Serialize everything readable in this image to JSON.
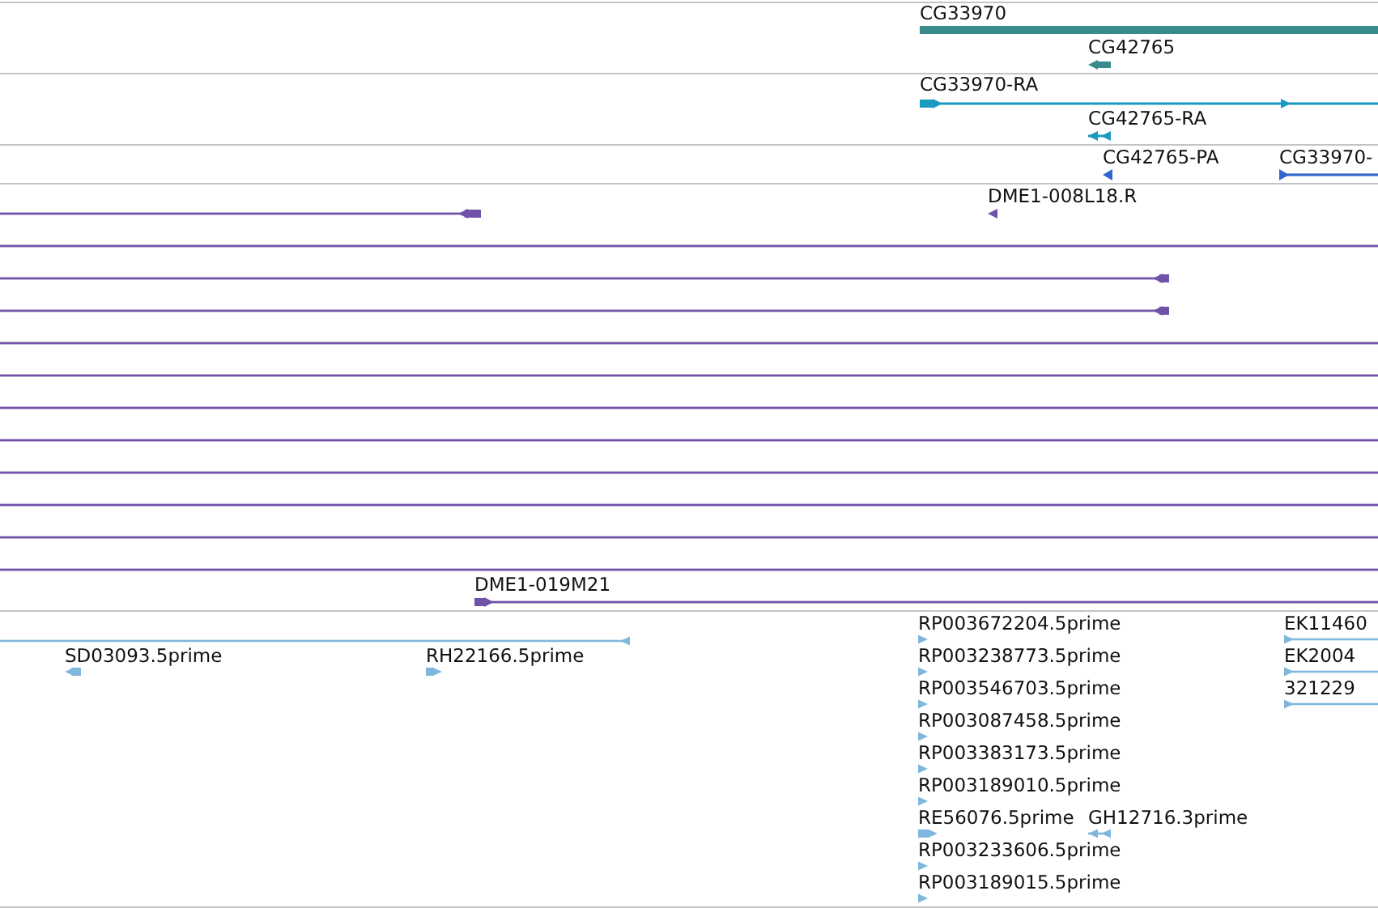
{
  "tracks": [
    {
      "kind": "gene",
      "color": "#3a8c8c",
      "features": [
        {
          "kind": "span",
          "label": "CG33970"
        },
        {
          "kind": "arrow",
          "label": "CG42765",
          "reverse": true
        }
      ]
    },
    {
      "kind": "transcript",
      "color": "#1b9ac0",
      "features": [
        {
          "kind": "arrow",
          "label": "CG33970-RA",
          "reverse": false
        },
        {
          "kind": "arrow",
          "label": "CG42765-RA",
          "reverse": true
        }
      ]
    },
    {
      "kind": "protein",
      "color": "#3366cc",
      "features": [
        {
          "kind": "arrow",
          "label": "CG42765-PA",
          "reverse": true
        },
        {
          "kind": "arrow",
          "label": "CG33970-",
          "reverse": false
        }
      ]
    },
    {
      "kind": "clone",
      "color": "#7052a8",
      "features": [
        {
          "kind": "arrow",
          "label": "DME1-008L18.R",
          "reverse": true
        },
        {
          "kind": "arrow",
          "reverse": true
        },
        {
          "kind": "span"
        },
        {
          "kind": "arrow",
          "reverse": true
        },
        {
          "kind": "arrow",
          "reverse": true
        },
        {
          "kind": "span"
        },
        {
          "kind": "span"
        },
        {
          "kind": "span"
        },
        {
          "kind": "span"
        },
        {
          "kind": "span"
        },
        {
          "kind": "span"
        },
        {
          "kind": "span"
        },
        {
          "kind": "span"
        },
        {
          "kind": "arrow",
          "label": "DME1-019M21",
          "reverse": false
        }
      ]
    },
    {
      "kind": "est",
      "color": "#7fb8dc",
      "features": [
        {
          "kind": "arrow",
          "reverse": true
        },
        {
          "kind": "arrow",
          "label": "RP003672204.5prime",
          "reverse": false
        },
        {
          "kind": "arrow",
          "label": "EK11460",
          "reverse": false
        },
        {
          "kind": "arrow",
          "label": "SD03093.5prime",
          "reverse": true
        },
        {
          "kind": "arrow",
          "label": "RH22166.5prime",
          "reverse": false
        },
        {
          "kind": "arrow",
          "label": "RP003238773.5prime",
          "reverse": false
        },
        {
          "kind": "arrow",
          "label": "EK2004",
          "reverse": false
        },
        {
          "kind": "arrow",
          "label": "RP003546703.5prime",
          "reverse": false
        },
        {
          "kind": "arrow",
          "label": "321229",
          "reverse": false
        },
        {
          "kind": "arrow",
          "label": "RP003087458.5prime",
          "reverse": false
        },
        {
          "kind": "arrow",
          "label": "RP003383173.5prime",
          "reverse": false
        },
        {
          "kind": "arrow",
          "label": "RP003189010.5prime",
          "reverse": false
        },
        {
          "kind": "arrow",
          "label": "RE56076.5prime",
          "reverse": false
        },
        {
          "kind": "arrow",
          "label": "GH12716.3prime",
          "reverse": true
        },
        {
          "kind": "arrow",
          "label": "RP003233606.5prime",
          "reverse": false
        },
        {
          "kind": "arrow",
          "label": "RP003189015.5prime",
          "reverse": false
        }
      ]
    }
  ]
}
